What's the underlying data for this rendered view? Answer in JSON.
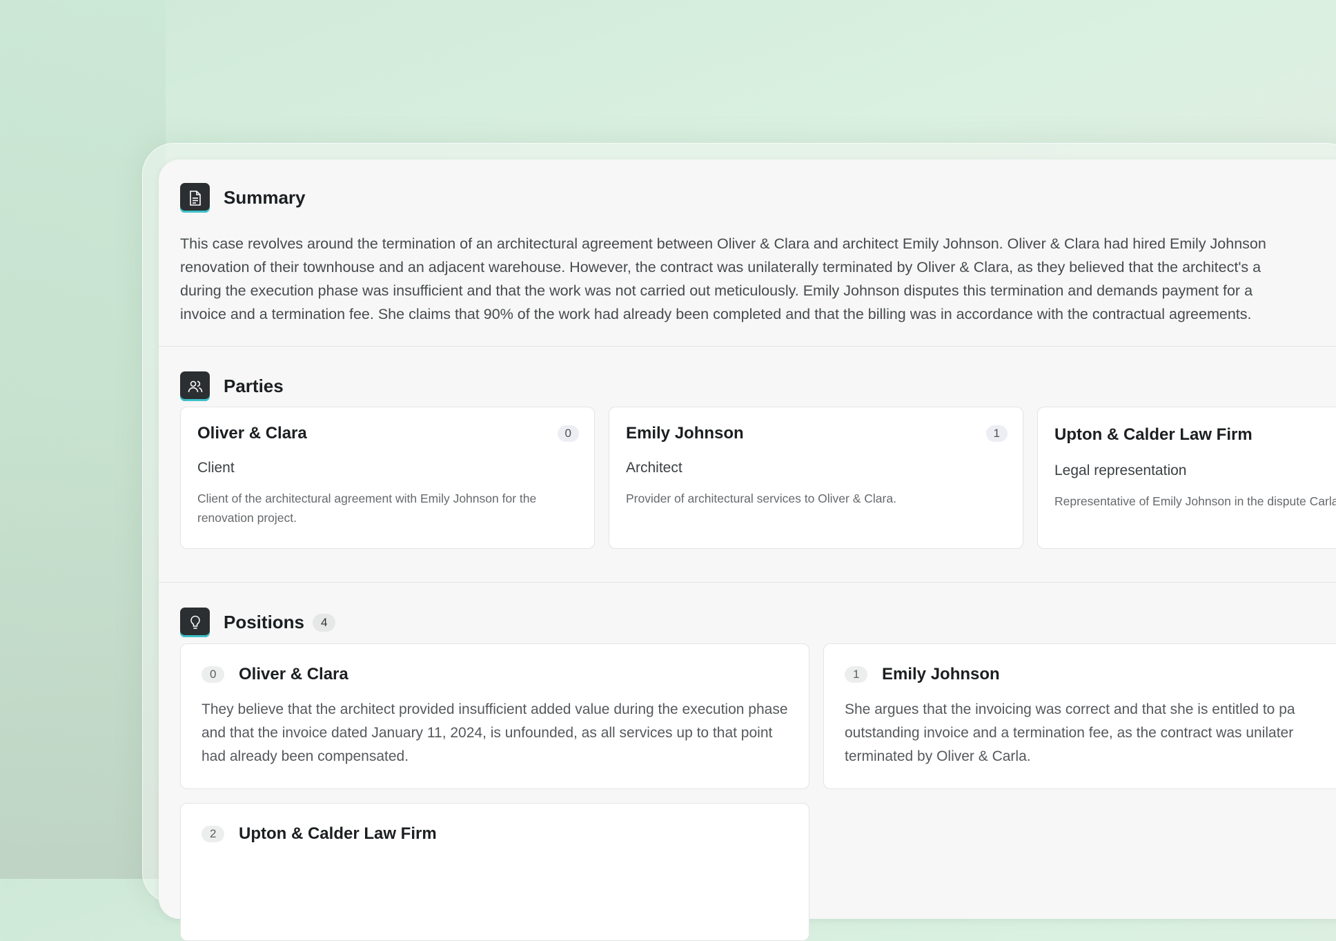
{
  "summary": {
    "title": "Summary",
    "icon": "document-icon",
    "lines": [
      "This case revolves around the termination of an architectural agreement between Oliver & Clara and architect Emily Johnson. Oliver & Clara had hired Emily Johnson",
      "renovation of their townhouse and an adjacent warehouse. However, the contract was unilaterally terminated by Oliver & Clara, as they believed that the architect's a",
      "during the execution phase was insufficient and that the work was not carried out meticulously. Emily Johnson disputes this termination and demands payment for a",
      "invoice and a termination fee. She claims that 90% of the work had already been completed and that the billing was in accordance with the contractual agreements."
    ]
  },
  "parties": {
    "title": "Parties",
    "icon": "users-icon",
    "items": [
      {
        "name": "Oliver & Clara",
        "badge": "0",
        "role": "Client",
        "description": "Client of the architectural agreement with Emily Johnson for the renovation project."
      },
      {
        "name": "Emily Johnson",
        "badge": "1",
        "role": "Architect",
        "description": "Provider of architectural services to Oliver & Clara."
      },
      {
        "name": "Upton & Calder Law Firm",
        "badge": "",
        "role": "Legal representation",
        "description": "Representative of Emily Johnson in the dispute Carla."
      }
    ]
  },
  "positions": {
    "title": "Positions",
    "count": "4",
    "icon": "lightbulb-icon",
    "items": [
      {
        "num": "0",
        "name": "Oliver & Clara",
        "text": "They believe that the architect provided insufficient added value during the execution phase and that the invoice dated January 11, 2024, is unfounded, as all services up to that point had already been compensated."
      },
      {
        "num": "1",
        "name": "Emily Johnson",
        "text": "She argues that the invoicing was correct and that she is entitled to pa outstanding invoice and a termination fee, as the contract was unilater terminated by Oliver & Carla."
      },
      {
        "num": "2",
        "name": "Upton & Calder Law Firm",
        "text": ""
      }
    ]
  },
  "colors": {
    "icon_bg": "#2b2f31",
    "icon_accent": "#3ec1c9",
    "panel": "#f6f7f6"
  }
}
